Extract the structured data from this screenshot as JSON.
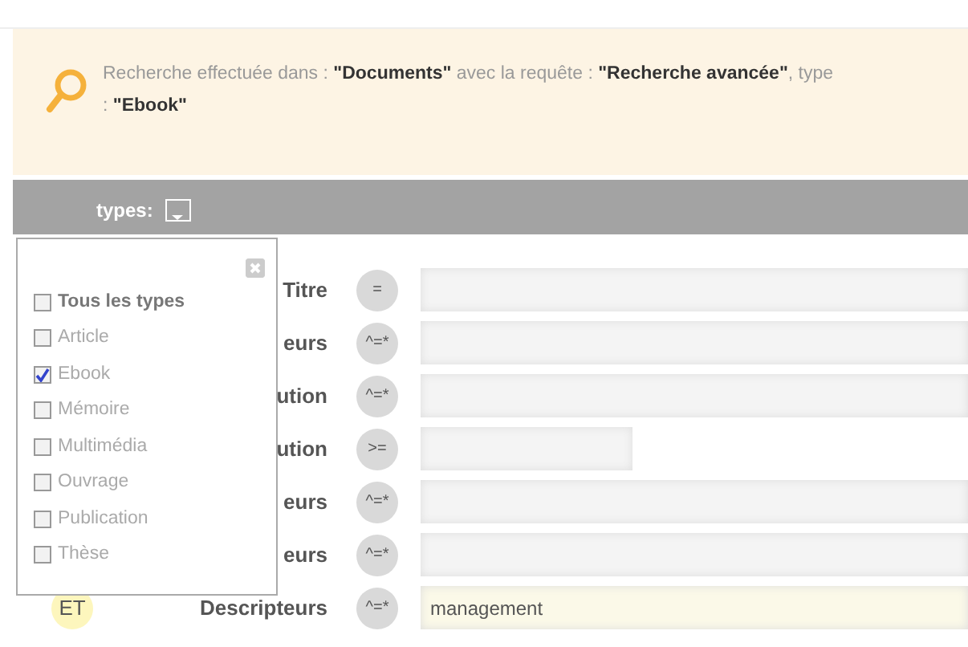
{
  "search_info": {
    "lines": [
      "Recherche effectuée dans : **\"Documents\"** avec la requête : **\"Recherche avancée\"**, type",
      ": **\"Ebook\"**"
    ]
  },
  "filter_bar": {
    "label": "types:"
  },
  "types_popup": {
    "items": [
      {
        "label": "Tous les types",
        "kind": "all",
        "checked": false
      },
      {
        "label": "Article",
        "kind": "type",
        "checked": false
      },
      {
        "label": "Ebook",
        "kind": "type",
        "checked": true
      },
      {
        "label": "Mémoire",
        "kind": "type",
        "checked": false
      },
      {
        "label": "Multimédia",
        "kind": "type",
        "checked": false
      },
      {
        "label": "Ouvrage",
        "kind": "type",
        "checked": false
      },
      {
        "label": "Publication",
        "kind": "type",
        "checked": false
      },
      {
        "label": "Thèse",
        "kind": "type",
        "checked": false
      }
    ]
  },
  "rows": [
    {
      "label": "Titre",
      "operator": "=",
      "kind": "full",
      "focused": false
    },
    {
      "label": "eurs",
      "operator": "^=*",
      "kind": "full",
      "focused": false
    },
    {
      "label": "ution",
      "operator": "^=*",
      "kind": "full",
      "focused": false
    },
    {
      "label": "ution",
      "operator": ">=",
      "kind": "short",
      "focused": false
    },
    {
      "label": "eurs",
      "operator": "^=*",
      "kind": "full",
      "focused": false
    },
    {
      "label": "eurs",
      "operator": "^=*",
      "kind": "full",
      "focused": false
    },
    {
      "connector": "ET",
      "label": "Descripteurs",
      "operator": "^=*",
      "kind": "full",
      "focused": true,
      "value": "management"
    }
  ]
}
